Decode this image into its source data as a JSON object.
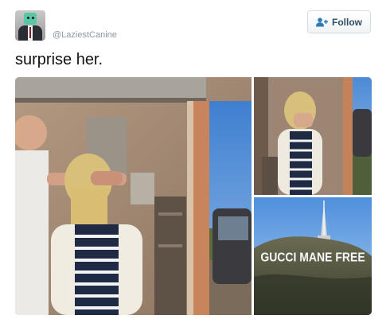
{
  "tweet": {
    "handle": "@LaziestCanine",
    "text": "surprise her."
  },
  "follow_button": {
    "label": "Follow",
    "icon": "add-user-icon"
  },
  "avatar": {
    "icon": "robot-in-suit-avatar"
  },
  "media": {
    "photos": [
      {
        "description_icon": "garage-surprise-photo"
      },
      {
        "description_icon": "woman-covering-face-photo"
      },
      {
        "description_icon": "hollywood-sign-photo",
        "sign_text": "GUCCI MANE FREE"
      }
    ]
  },
  "colors": {
    "follow_text": "#2f4f63",
    "handle_text": "#8899a6"
  }
}
